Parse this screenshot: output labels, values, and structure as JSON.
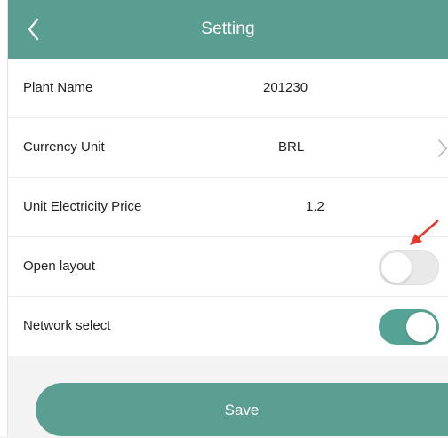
{
  "header": {
    "title": "Setting",
    "back_icon": "chevron-left-icon",
    "background": "#5a9e91"
  },
  "settings": {
    "plant_name": {
      "label": "Plant Name",
      "value": "201230"
    },
    "currency_unit": {
      "label": "Currency Unit",
      "value": "BRL",
      "icon": "chevron-right-icon"
    },
    "electricity_price": {
      "label": "Unit Electricity Price",
      "value": "1.2"
    },
    "open_layout": {
      "label": "Open layout",
      "enabled": false
    },
    "network_select": {
      "label": "Network select",
      "enabled": true
    }
  },
  "save_button": {
    "label": "Save"
  },
  "annotation": {
    "icon": "red-arrow-icon",
    "color": "#e8382b"
  },
  "colors": {
    "accent": "#5a9e91",
    "toggle_on": "#55a394",
    "toggle_off": "#e9e9e9"
  }
}
